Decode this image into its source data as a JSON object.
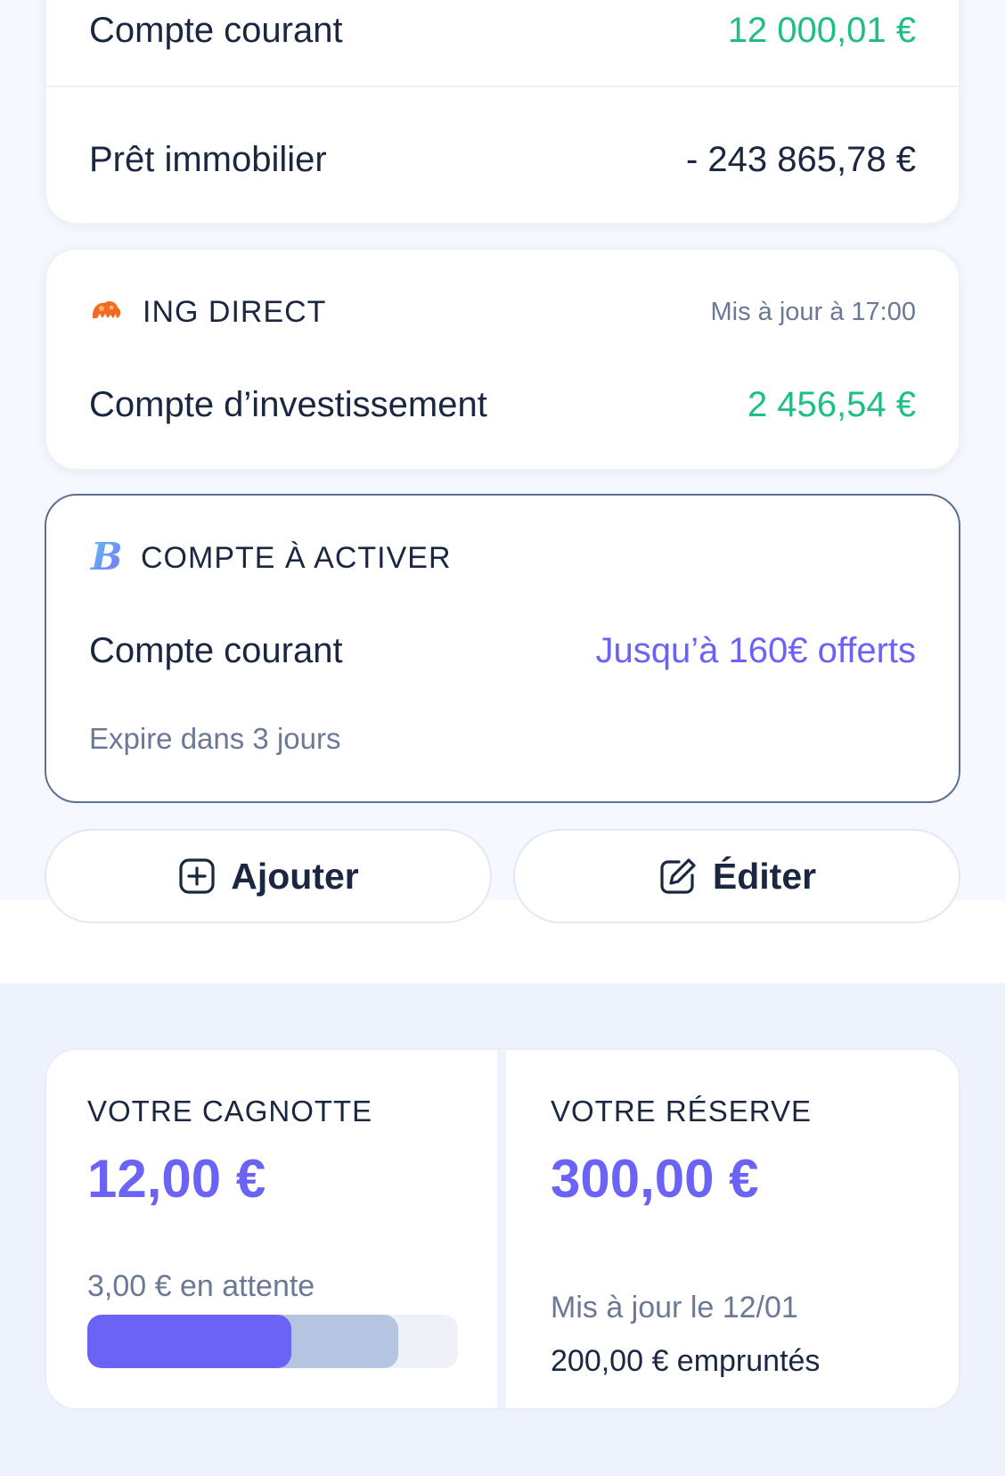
{
  "accounts_card": {
    "rows": [
      {
        "label": "Compte courant",
        "value": "12 000,01 €"
      },
      {
        "label": "Prêt immobilier",
        "value": "- 243 865,78 €"
      }
    ]
  },
  "ing_card": {
    "bank_name": "ING DIRECT",
    "logo_icon": "lion-icon",
    "updated": "Mis à jour à 17:00",
    "account_label": "Compte d’investissement",
    "account_value": "2 456,54 €"
  },
  "activate_card": {
    "logo_icon": "b-logo-icon",
    "title": "COMPTE À ACTIVER",
    "account_label": "Compte courant",
    "offer": "Jusqu’à 160€ offerts",
    "expire": "Expire dans 3 jours"
  },
  "actions": {
    "add_label": "Ajouter",
    "edit_label": "Éditer"
  },
  "cagnotte": {
    "label": "VOTRE CAGNOTTE",
    "amount": "12,00 €",
    "pending": "3,00 € en attente",
    "progress_fraction": 0.55,
    "pending_fraction": 0.84
  },
  "reserve": {
    "label": "VOTRE RÉSERVE",
    "amount": "300,00 €",
    "updated": "Mis à jour le 12/01",
    "borrowed": "200,00 € empruntés"
  },
  "colors": {
    "positive": "#1fbf82",
    "accent": "#6b63f5",
    "text": "#1b2740",
    "muted": "#6b7896"
  }
}
